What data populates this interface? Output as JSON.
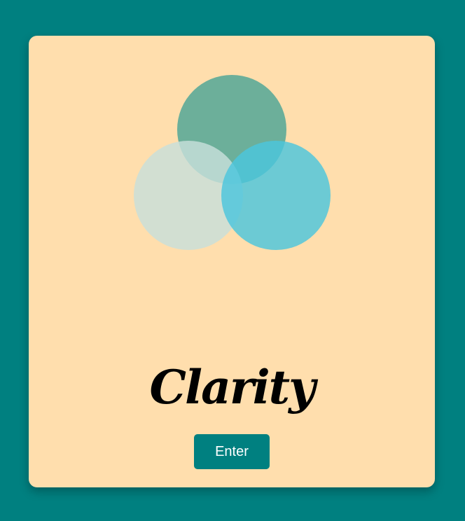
{
  "page": {
    "background_color": "#008080"
  },
  "card": {
    "background_color": "#FFDEAD"
  },
  "logo": {
    "circles": [
      {
        "name": "top-circle",
        "color": "#5FAA98"
      },
      {
        "name": "left-circle",
        "color": "#C8DFDA"
      },
      {
        "name": "right-circle",
        "color": "#4CC6DD"
      }
    ]
  },
  "title": "Clarity",
  "enter_button": {
    "label": "Enter",
    "background_color": "#008080",
    "text_color": "#FFFFFF"
  }
}
